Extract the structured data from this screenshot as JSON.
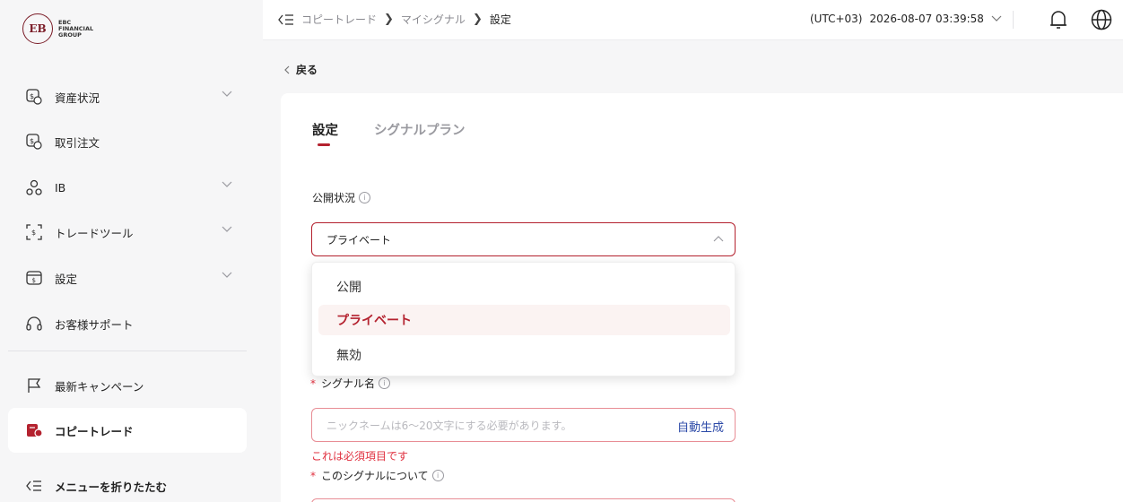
{
  "logo": {
    "mark": "EB",
    "line1": "EBC",
    "line2": "FINANCIAL",
    "line3": "GROUP"
  },
  "sidebar": {
    "items": [
      {
        "label": "資産状況",
        "icon": "dollar-chart-icon",
        "has_chevron": true
      },
      {
        "label": "取引注文",
        "icon": "dollar-coins-icon",
        "has_chevron": false
      },
      {
        "label": "IB",
        "icon": "people-network-icon",
        "has_chevron": true
      },
      {
        "label": "トレードツール",
        "icon": "scan-dollar-icon",
        "has_chevron": true
      },
      {
        "label": "設定",
        "icon": "wallet-icon",
        "has_chevron": true
      },
      {
        "label": "お客様サポート",
        "icon": "headset-icon",
        "has_chevron": false
      },
      {
        "label": "最新キャンペーン",
        "icon": "flag-icon",
        "has_chevron": false
      },
      {
        "label": "コピートレード",
        "icon": "copy-trade-icon",
        "has_chevron": false,
        "active": true
      }
    ],
    "collapse_label": "メニューを折りたたむ"
  },
  "header": {
    "breadcrumb": [
      "コピートレード",
      "マイシグナル",
      "設定"
    ],
    "timezone": "(UTC+03)",
    "datetime": "2026-08-07 03:39:58"
  },
  "back_label": "戻る",
  "tabs": [
    {
      "label": "設定",
      "active": true
    },
    {
      "label": "シグナルプラン",
      "active": false
    }
  ],
  "form": {
    "visibility": {
      "label": "公開状況",
      "value": "プライベート",
      "options": [
        "公開",
        "プライベート",
        "無効"
      ],
      "selected_index": 1
    },
    "signal_name": {
      "label": "シグナル名",
      "required_mark": "*",
      "placeholder": "ニックネームは6〜20文字にする必要があります。",
      "auto_label": "自動生成",
      "error": "これは必須項目です"
    },
    "about": {
      "label": "このシグナルについて",
      "required_mark": "*"
    }
  },
  "colors": {
    "brand": "#b4222f",
    "error": "#e0303f",
    "link": "#2c4aa8"
  }
}
